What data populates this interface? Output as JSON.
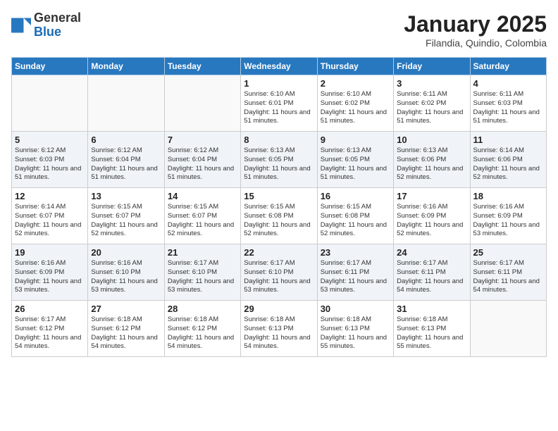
{
  "header": {
    "logo_general": "General",
    "logo_blue": "Blue",
    "title": "January 2025",
    "subtitle": "Filandia, Quindio, Colombia"
  },
  "weekdays": [
    "Sunday",
    "Monday",
    "Tuesday",
    "Wednesday",
    "Thursday",
    "Friday",
    "Saturday"
  ],
  "weeks": [
    [
      {
        "day": "",
        "info": ""
      },
      {
        "day": "",
        "info": ""
      },
      {
        "day": "",
        "info": ""
      },
      {
        "day": "1",
        "info": "Sunrise: 6:10 AM\nSunset: 6:01 PM\nDaylight: 11 hours\nand 51 minutes."
      },
      {
        "day": "2",
        "info": "Sunrise: 6:10 AM\nSunset: 6:02 PM\nDaylight: 11 hours\nand 51 minutes."
      },
      {
        "day": "3",
        "info": "Sunrise: 6:11 AM\nSunset: 6:02 PM\nDaylight: 11 hours\nand 51 minutes."
      },
      {
        "day": "4",
        "info": "Sunrise: 6:11 AM\nSunset: 6:03 PM\nDaylight: 11 hours\nand 51 minutes."
      }
    ],
    [
      {
        "day": "5",
        "info": "Sunrise: 6:12 AM\nSunset: 6:03 PM\nDaylight: 11 hours\nand 51 minutes."
      },
      {
        "day": "6",
        "info": "Sunrise: 6:12 AM\nSunset: 6:04 PM\nDaylight: 11 hours\nand 51 minutes."
      },
      {
        "day": "7",
        "info": "Sunrise: 6:12 AM\nSunset: 6:04 PM\nDaylight: 11 hours\nand 51 minutes."
      },
      {
        "day": "8",
        "info": "Sunrise: 6:13 AM\nSunset: 6:05 PM\nDaylight: 11 hours\nand 51 minutes."
      },
      {
        "day": "9",
        "info": "Sunrise: 6:13 AM\nSunset: 6:05 PM\nDaylight: 11 hours\nand 51 minutes."
      },
      {
        "day": "10",
        "info": "Sunrise: 6:13 AM\nSunset: 6:06 PM\nDaylight: 11 hours\nand 52 minutes."
      },
      {
        "day": "11",
        "info": "Sunrise: 6:14 AM\nSunset: 6:06 PM\nDaylight: 11 hours\nand 52 minutes."
      }
    ],
    [
      {
        "day": "12",
        "info": "Sunrise: 6:14 AM\nSunset: 6:07 PM\nDaylight: 11 hours\nand 52 minutes."
      },
      {
        "day": "13",
        "info": "Sunrise: 6:15 AM\nSunset: 6:07 PM\nDaylight: 11 hours\nand 52 minutes."
      },
      {
        "day": "14",
        "info": "Sunrise: 6:15 AM\nSunset: 6:07 PM\nDaylight: 11 hours\nand 52 minutes."
      },
      {
        "day": "15",
        "info": "Sunrise: 6:15 AM\nSunset: 6:08 PM\nDaylight: 11 hours\nand 52 minutes."
      },
      {
        "day": "16",
        "info": "Sunrise: 6:15 AM\nSunset: 6:08 PM\nDaylight: 11 hours\nand 52 minutes."
      },
      {
        "day": "17",
        "info": "Sunrise: 6:16 AM\nSunset: 6:09 PM\nDaylight: 11 hours\nand 52 minutes."
      },
      {
        "day": "18",
        "info": "Sunrise: 6:16 AM\nSunset: 6:09 PM\nDaylight: 11 hours\nand 53 minutes."
      }
    ],
    [
      {
        "day": "19",
        "info": "Sunrise: 6:16 AM\nSunset: 6:09 PM\nDaylight: 11 hours\nand 53 minutes."
      },
      {
        "day": "20",
        "info": "Sunrise: 6:16 AM\nSunset: 6:10 PM\nDaylight: 11 hours\nand 53 minutes."
      },
      {
        "day": "21",
        "info": "Sunrise: 6:17 AM\nSunset: 6:10 PM\nDaylight: 11 hours\nand 53 minutes."
      },
      {
        "day": "22",
        "info": "Sunrise: 6:17 AM\nSunset: 6:10 PM\nDaylight: 11 hours\nand 53 minutes."
      },
      {
        "day": "23",
        "info": "Sunrise: 6:17 AM\nSunset: 6:11 PM\nDaylight: 11 hours\nand 53 minutes."
      },
      {
        "day": "24",
        "info": "Sunrise: 6:17 AM\nSunset: 6:11 PM\nDaylight: 11 hours\nand 54 minutes."
      },
      {
        "day": "25",
        "info": "Sunrise: 6:17 AM\nSunset: 6:11 PM\nDaylight: 11 hours\nand 54 minutes."
      }
    ],
    [
      {
        "day": "26",
        "info": "Sunrise: 6:17 AM\nSunset: 6:12 PM\nDaylight: 11 hours\nand 54 minutes."
      },
      {
        "day": "27",
        "info": "Sunrise: 6:18 AM\nSunset: 6:12 PM\nDaylight: 11 hours\nand 54 minutes."
      },
      {
        "day": "28",
        "info": "Sunrise: 6:18 AM\nSunset: 6:12 PM\nDaylight: 11 hours\nand 54 minutes."
      },
      {
        "day": "29",
        "info": "Sunrise: 6:18 AM\nSunset: 6:13 PM\nDaylight: 11 hours\nand 54 minutes."
      },
      {
        "day": "30",
        "info": "Sunrise: 6:18 AM\nSunset: 6:13 PM\nDaylight: 11 hours\nand 55 minutes."
      },
      {
        "day": "31",
        "info": "Sunrise: 6:18 AM\nSunset: 6:13 PM\nDaylight: 11 hours\nand 55 minutes."
      },
      {
        "day": "",
        "info": ""
      }
    ]
  ]
}
